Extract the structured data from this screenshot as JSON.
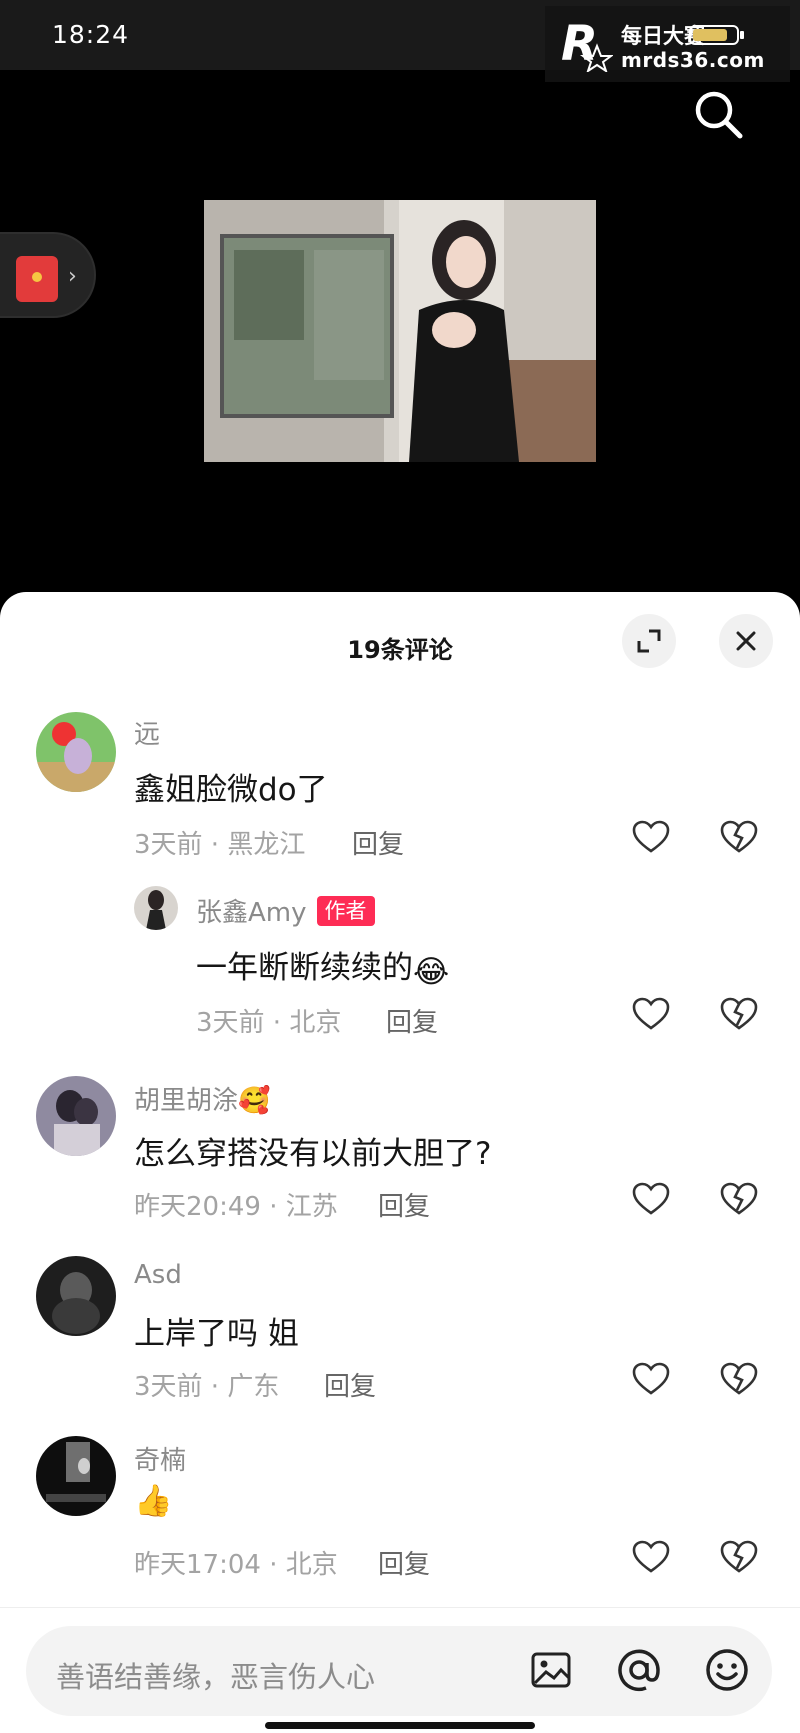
{
  "status_bar": {
    "time": "18:24"
  },
  "watermark": {
    "logo_letter": "R",
    "title": "每日大赛",
    "url": "mrds36.com"
  },
  "comments_panel": {
    "title": "19条评论",
    "comments": [
      {
        "user": "远",
        "text": "鑫姐脸微do了",
        "meta": "3天前 · 黑龙江",
        "reply_label": "回复"
      },
      {
        "user": "张鑫Amy",
        "badge": "作者",
        "text": "一年断断续续的",
        "text_emoji": "😂",
        "meta": "3天前 · 北京",
        "reply_label": "回复"
      },
      {
        "user": "胡里胡涂",
        "user_emoji": "🥰",
        "text": "怎么穿搭没有以前大胆了?",
        "meta": "昨天20:49 · 江苏",
        "reply_label": "回复"
      },
      {
        "user": "Asd",
        "text": "上岸了吗 姐",
        "meta": "3天前 · 广东",
        "reply_label": "回复"
      },
      {
        "user": "奇楠",
        "text_emoji": "👍",
        "meta": "昨天17:04 · 北京",
        "reply_label": "回复"
      }
    ]
  },
  "input": {
    "placeholder": "善语结善缘，恶言伤人心"
  },
  "icons": [
    "search-icon",
    "red-packet-icon",
    "expand-icon",
    "close-icon",
    "like-icon",
    "dislike-icon",
    "image-icon",
    "mention-icon",
    "emoji-icon"
  ],
  "colors": {
    "accent": "#fe2c55",
    "sheet_bg": "#ffffff",
    "muted_text": "#a3a3a3"
  }
}
